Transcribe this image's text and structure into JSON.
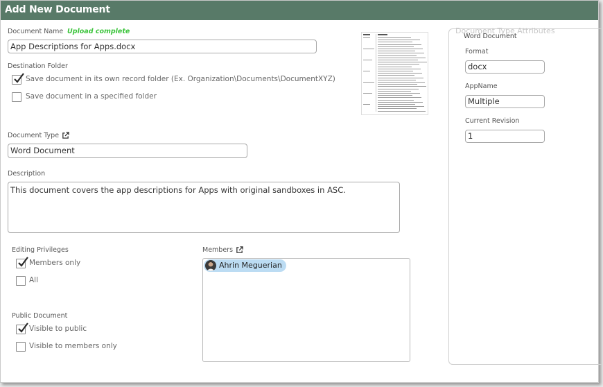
{
  "dialog": {
    "title": "Add New Document"
  },
  "document_name": {
    "label": "Document Name",
    "status": "Upload complete",
    "value": "App Descriptions for Apps.docx"
  },
  "destination_folder": {
    "label": "Destination Folder",
    "options": [
      {
        "label": "Save document in its own record folder (Ex. Organization\\Documents\\DocumentXYZ)",
        "checked": true
      },
      {
        "label": "Save document in a specified folder",
        "checked": false
      }
    ]
  },
  "document_type": {
    "label": "Document Type",
    "value": "Word Document",
    "icon": "external-link-icon"
  },
  "description": {
    "label": "Description",
    "value": "This document covers the app descriptions for Apps with original sandboxes in ASC."
  },
  "editing_privileges": {
    "label": "Editing Privileges",
    "options": [
      {
        "label": "Members only",
        "checked": true
      },
      {
        "label": "All",
        "checked": false
      }
    ]
  },
  "public_document": {
    "label": "Public Document",
    "options": [
      {
        "label": "Visible to public",
        "checked": true
      },
      {
        "label": "Visible to members only",
        "checked": false
      }
    ]
  },
  "members": {
    "label": "Members",
    "icon": "external-link-icon",
    "items": [
      {
        "name": "Ahrin Meguerian"
      }
    ]
  },
  "attributes": {
    "legend": "Document Type Attributes",
    "type_name": "Word Document",
    "fields": [
      {
        "label": "Format",
        "value": "docx"
      },
      {
        "label": "AppName",
        "value": "Multiple"
      },
      {
        "label": "Current Revision",
        "value": "1"
      }
    ]
  },
  "colors": {
    "title_bar": "#587a68",
    "status_green": "#3bc43b",
    "chip_blue": "#bcdcf3"
  }
}
